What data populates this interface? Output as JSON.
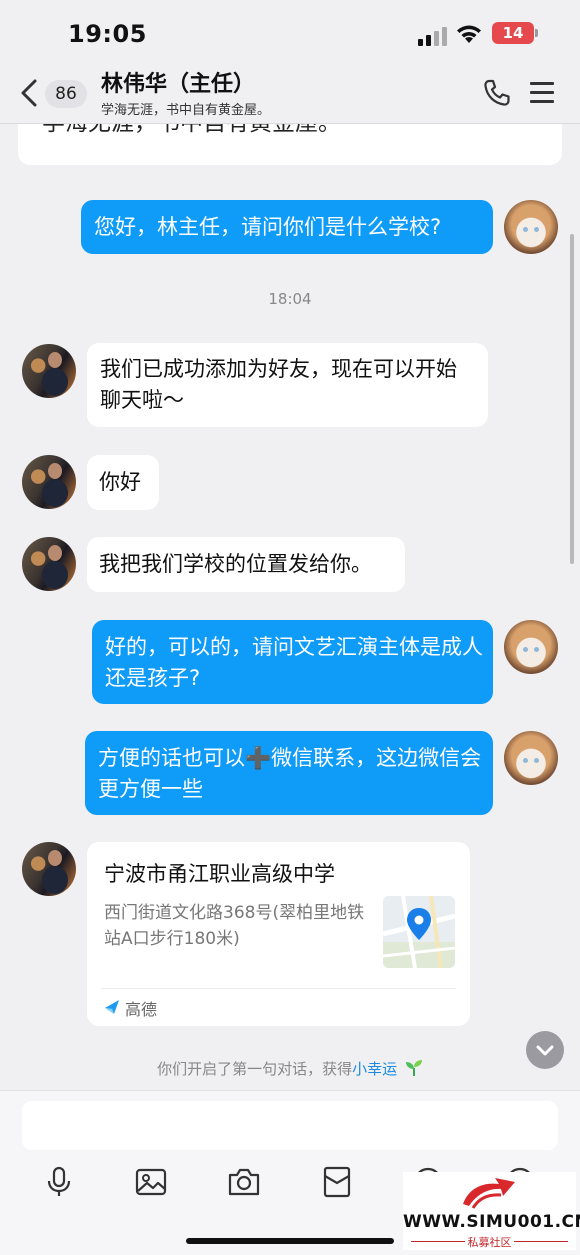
{
  "status_bar": {
    "time": "19:05",
    "battery": "14"
  },
  "header": {
    "back_icon": "chevron-left-icon",
    "unread_count": "86",
    "name": "林伟华（主任）",
    "signature": "学海无涯，书中自有黄金屋。",
    "call_icon": "phone-icon",
    "menu_icon": "menu-icon"
  },
  "messages": [
    {
      "side": "in",
      "type": "text",
      "text": "学海无涯，书中自有黄金屋。"
    },
    {
      "side": "out",
      "type": "text",
      "text": "您好，林主任，请问你们是什么学校?"
    },
    {
      "type": "time",
      "text": "18:04"
    },
    {
      "side": "in",
      "type": "text",
      "text": "我们已成功添加为好友，现在可以开始聊天啦～"
    },
    {
      "side": "in",
      "type": "text",
      "text": "你好"
    },
    {
      "side": "in",
      "type": "text",
      "text": "我把我们学校的位置发给你。"
    },
    {
      "side": "out",
      "type": "text",
      "text": "好的，可以的，请问文艺汇演主体是成人还是孩子?"
    },
    {
      "side": "out",
      "type": "text",
      "text": "方便的话也可以➕微信联系，这边微信会更方便一些"
    },
    {
      "side": "in",
      "type": "location",
      "title": "宁波市甬江职业高级中学",
      "address": "西门街道文化路368号(翠柏里地铁站A口步行180米)",
      "source": "高德"
    }
  ],
  "system_notice": {
    "prefix": "你们开启了第一句对话，获得",
    "link": "小幸运"
  },
  "input": {
    "placeholder": ""
  },
  "toolbar": [
    "microphone-icon",
    "image-icon",
    "camera-icon",
    "red-packet-icon",
    "emoji-icon",
    "plus-icon"
  ],
  "watermark": {
    "site": "WWW.SIMU001.CN",
    "sub": "私募社区"
  },
  "colors": {
    "outgoing_bubble": "#0f9bf8",
    "incoming_bubble": "#ffffff",
    "background": "#f0f0f2",
    "link": "#1a8be0"
  }
}
